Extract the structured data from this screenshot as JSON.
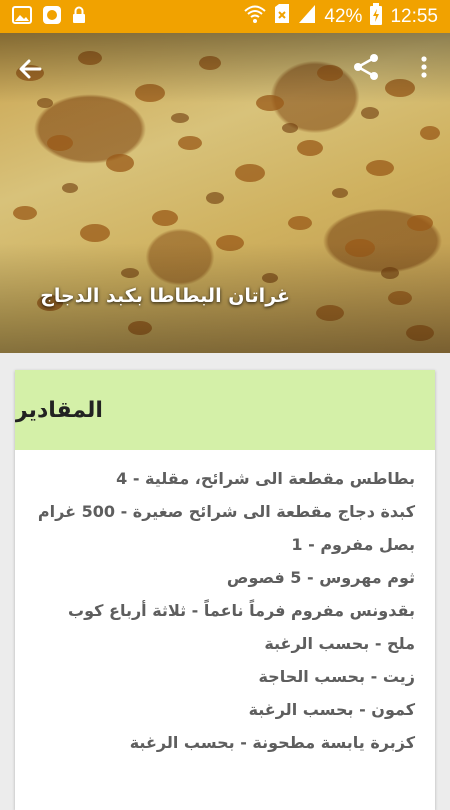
{
  "status_bar": {
    "battery_percent": "42%",
    "time": "12:55",
    "icons": [
      "image-icon",
      "app-icon",
      "lock-icon",
      "wifi-icon",
      "sim-icon",
      "signal-icon",
      "battery-charging-icon"
    ]
  },
  "recipe": {
    "title": "غراتان البطاطا بكبد الدجاج"
  },
  "toolbar": {
    "back_icon": "back-arrow-icon",
    "share_icon": "share-icon",
    "more_icon": "more-vert-icon"
  },
  "ingredients": {
    "heading": "المقادير",
    "items": [
      "بطاطس مقطعة الى شرائح، مقلية - 4",
      "كبدة دجاج مقطعة الى شرائح صغيرة - 500 غرام",
      "بصل مفروم - 1",
      "ثوم مهروس - 5 فصوص",
      "بقدونس مفروم فرماً ناعماً - ثلاثة أرباع كوب",
      "ملح - بحسب الرغبة",
      "زيت - بحسب الحاجة",
      "كمون - بحسب الرغبة",
      "كزبرة يابسة مطحونة - بحسب الرغبة"
    ]
  },
  "colors": {
    "status_bar": "#f1a200",
    "card_header": "#d4f0a8",
    "ingredient_text": "#5e5e5e"
  }
}
